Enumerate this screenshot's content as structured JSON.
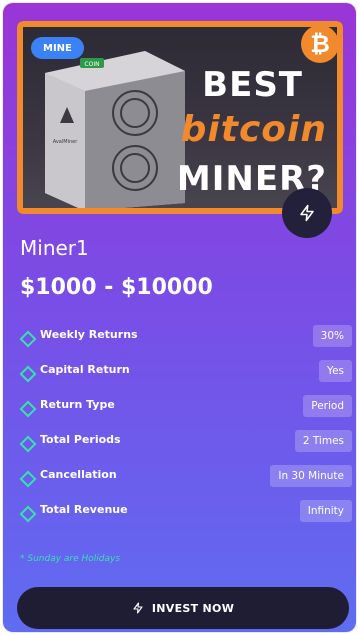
{
  "card": {
    "badge": "MINE",
    "thumbnail": {
      "line1": "BEST",
      "line2": "bitcoin",
      "line3": "MINER?",
      "coin_symbol": "₿",
      "device_brand": "AvalMiner",
      "device_logo_text": "COIN"
    },
    "title": "Miner1",
    "price_range": "$1000 - $10000",
    "details": [
      {
        "label": "Weekly Returns",
        "value": "30%"
      },
      {
        "label": "Capital Return",
        "value": "Yes"
      },
      {
        "label": "Return Type",
        "value": "Period"
      },
      {
        "label": "Total Periods",
        "value": "2 Times"
      },
      {
        "label": "Cancellation",
        "value": "In 30 Minute"
      },
      {
        "label": "Total Revenue",
        "value": "Infinity"
      }
    ],
    "note": "* Sunday are Holidays",
    "invest_button": "INVEST NOW",
    "icons": [
      "bolt-icon",
      "diamond-icon",
      "bitcoin-icon"
    ],
    "colors": {
      "gradient_top": "#9a35d6",
      "gradient_bottom": "#5f6cf2",
      "accent_teal": "#38e0b0",
      "button_bg": "#1f1d33",
      "thumb_orange": "#f08a2c",
      "badge_blue": "#3b82f6"
    }
  }
}
